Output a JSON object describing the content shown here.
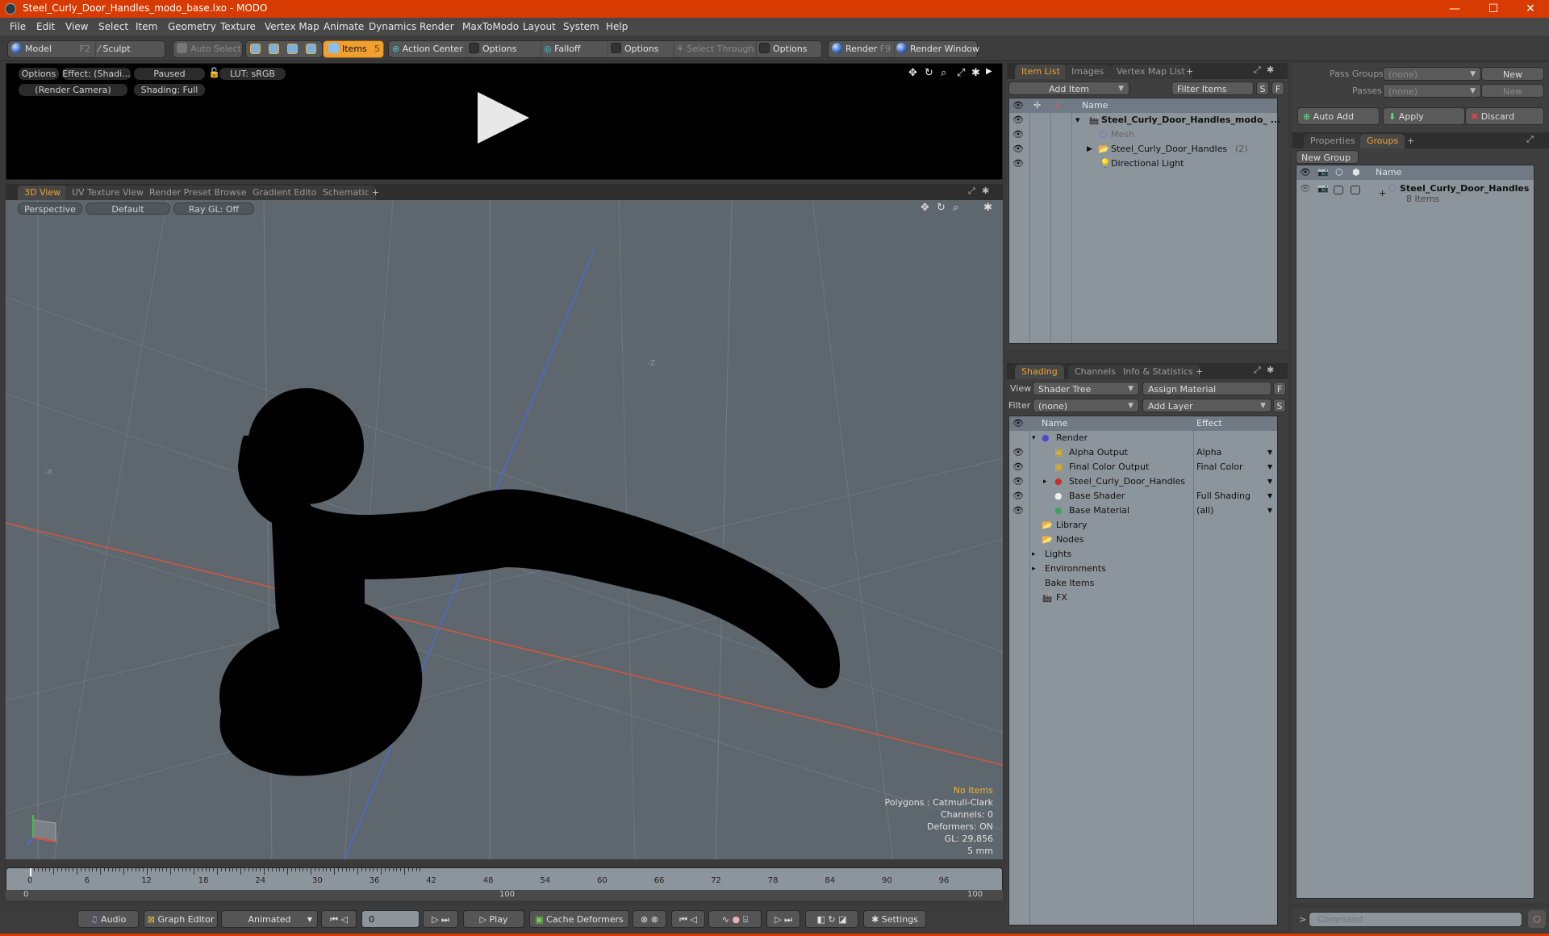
{
  "window": {
    "title": "Steel_Curly_Door_Handles_modo_base.lxo - MODO",
    "minimize": "—",
    "maximize": "☐",
    "close": "✕"
  },
  "menu": [
    "File",
    "Edit",
    "View",
    "Select",
    "Item",
    "Geometry",
    "Texture",
    "Vertex Map",
    "Animate",
    "Dynamics",
    "Render",
    "MaxToModo",
    "Layout",
    "System",
    "Help"
  ],
  "toolbar": {
    "model": "Model",
    "model_key": "F2",
    "sculpt": "Sculpt",
    "auto_select": "Auto Select",
    "items": "Items",
    "items_count": "5",
    "action_center": "Action Center",
    "options1": "Options",
    "falloff": "Falloff",
    "options2": "Options",
    "select_through": "Select Through",
    "options3": "Options",
    "render": "Render",
    "render_key": "F9",
    "render_window": "Render Window"
  },
  "render_view": {
    "options": "Options",
    "effect": "Effect: (Shadi...",
    "status": "Paused",
    "lut": "LUT: sRGB",
    "camera": "(Render Camera)",
    "shading": "Shading: Full"
  },
  "view_tabs": [
    "3D View",
    "UV Texture View",
    "Render Preset Browser",
    "Gradient Editor",
    "Schematic",
    "+"
  ],
  "viewport": {
    "projection": "Perspective",
    "style": "Default",
    "raygl": "Ray GL: Off",
    "axis_label_z": "-Z",
    "axis_label_x": "-X",
    "hud": {
      "selection": "No Items",
      "polygons": "Polygons : Catmull-Clark",
      "channels": "Channels: 0",
      "deformers": "Deformers: ON",
      "gl": "GL: 29,856",
      "unit": "5 mm"
    },
    "colors": {
      "x_axis": "#d9533c",
      "z_axis": "#4a6bd8",
      "y_axis": "#3cc43c"
    }
  },
  "timeline": {
    "ticks": [
      "0",
      "6",
      "12",
      "18",
      "24",
      "30",
      "36",
      "42",
      "48",
      "54",
      "60",
      "66",
      "72",
      "78",
      "84",
      "90",
      "96"
    ],
    "range_start": "0",
    "range_mid": "100",
    "range_end": "100",
    "current_frame": 0
  },
  "transport": {
    "audio": "Audio",
    "graph_editor": "Graph Editor",
    "mode": "Animated",
    "frame": "0",
    "play": "Play",
    "cache_deformers": "Cache Deformers",
    "settings": "Settings"
  },
  "item_list": {
    "tabs": [
      "Item List",
      "Images",
      "Vertex Map List",
      "+"
    ],
    "add_item": "Add Item",
    "filter": "Filter Items",
    "s": "S",
    "f": "F",
    "col_name": "Name",
    "rows": [
      {
        "name": "Steel_Curly_Door_Handles_modo_ ...",
        "bold": true
      },
      {
        "name": "Mesh",
        "dim": true
      },
      {
        "name": "Steel_Curly_Door_Handles",
        "suffix": "(2)"
      },
      {
        "name": "Directional Light"
      }
    ]
  },
  "shading": {
    "tabs": [
      "Shading",
      "Channels",
      "Info & Statistics",
      "+"
    ],
    "view_label": "View",
    "view_value": "Shader Tree",
    "assign": "Assign Material",
    "f": "F",
    "filter_label": "Filter",
    "filter_value": "(none)",
    "add_layer": "Add Layer",
    "s": "S",
    "col_name": "Name",
    "col_effect": "Effect",
    "rows": [
      {
        "name": "Render",
        "effect": ""
      },
      {
        "name": "Alpha Output",
        "effect": "Alpha"
      },
      {
        "name": "Final Color Output",
        "effect": "Final Color"
      },
      {
        "name": "Steel_Curly_Door_Handles",
        "effect": ""
      },
      {
        "name": "Base Shader",
        "effect": "Full Shading"
      },
      {
        "name": "Base Material",
        "effect": "(all)"
      },
      {
        "name": "Library",
        "effect": ""
      },
      {
        "name": "Nodes",
        "effect": ""
      },
      {
        "name": "Lights",
        "effect": ""
      },
      {
        "name": "Environments",
        "effect": ""
      },
      {
        "name": "Bake Items",
        "effect": ""
      },
      {
        "name": "FX",
        "effect": ""
      }
    ]
  },
  "passes": {
    "pass_groups_label": "Pass Groups",
    "pass_groups_value": "(none)",
    "new1": "New",
    "passes_label": "Passes",
    "passes_value": "(none)",
    "new2": "New",
    "auto_add": "Auto Add",
    "apply": "Apply",
    "discard": "Discard"
  },
  "groups": {
    "tabs": [
      "Properties",
      "Groups",
      "+"
    ],
    "new_group": "New Group",
    "col_name": "Name",
    "group_name": "Steel_Curly_Door_Handles",
    "group_count": "8 Items"
  },
  "command": {
    "prompt": ">",
    "placeholder": "Command"
  }
}
